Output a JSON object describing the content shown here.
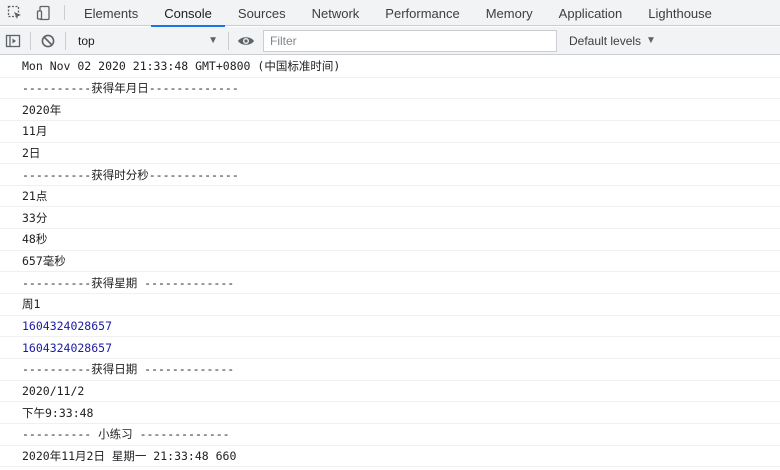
{
  "tabs": [
    "Elements",
    "Console",
    "Sources",
    "Network",
    "Performance",
    "Memory",
    "Application",
    "Lighthouse"
  ],
  "active_tab": "Console",
  "toolbar": {
    "context": "top",
    "filter_placeholder": "Filter",
    "filter_value": "",
    "levels_label": "Default levels"
  },
  "console_lines": [
    {
      "text": "Mon Nov 02 2020 21:33:48 GMT+0800 (中国标准时间)",
      "kind": "text"
    },
    {
      "text": "----------获得年月日-------------",
      "kind": "text"
    },
    {
      "text": "2020年",
      "kind": "text"
    },
    {
      "text": "11月",
      "kind": "text"
    },
    {
      "text": "2日",
      "kind": "text"
    },
    {
      "text": "----------获得时分秒-------------",
      "kind": "text"
    },
    {
      "text": "21点",
      "kind": "text"
    },
    {
      "text": "33分",
      "kind": "text"
    },
    {
      "text": "48秒",
      "kind": "text"
    },
    {
      "text": "657毫秒",
      "kind": "text"
    },
    {
      "text": "----------获得星期 -------------",
      "kind": "text"
    },
    {
      "text": "周1",
      "kind": "text"
    },
    {
      "text": "1604324028657",
      "kind": "number"
    },
    {
      "text": "1604324028657",
      "kind": "number"
    },
    {
      "text": "----------获得日期 -------------",
      "kind": "text"
    },
    {
      "text": "2020/11/2",
      "kind": "text"
    },
    {
      "text": "下午9:33:48",
      "kind": "text"
    },
    {
      "text": "---------- 小练习 -------------",
      "kind": "text"
    },
    {
      "text": "2020年11月2日 星期一 21:33:48 660",
      "kind": "text"
    }
  ]
}
